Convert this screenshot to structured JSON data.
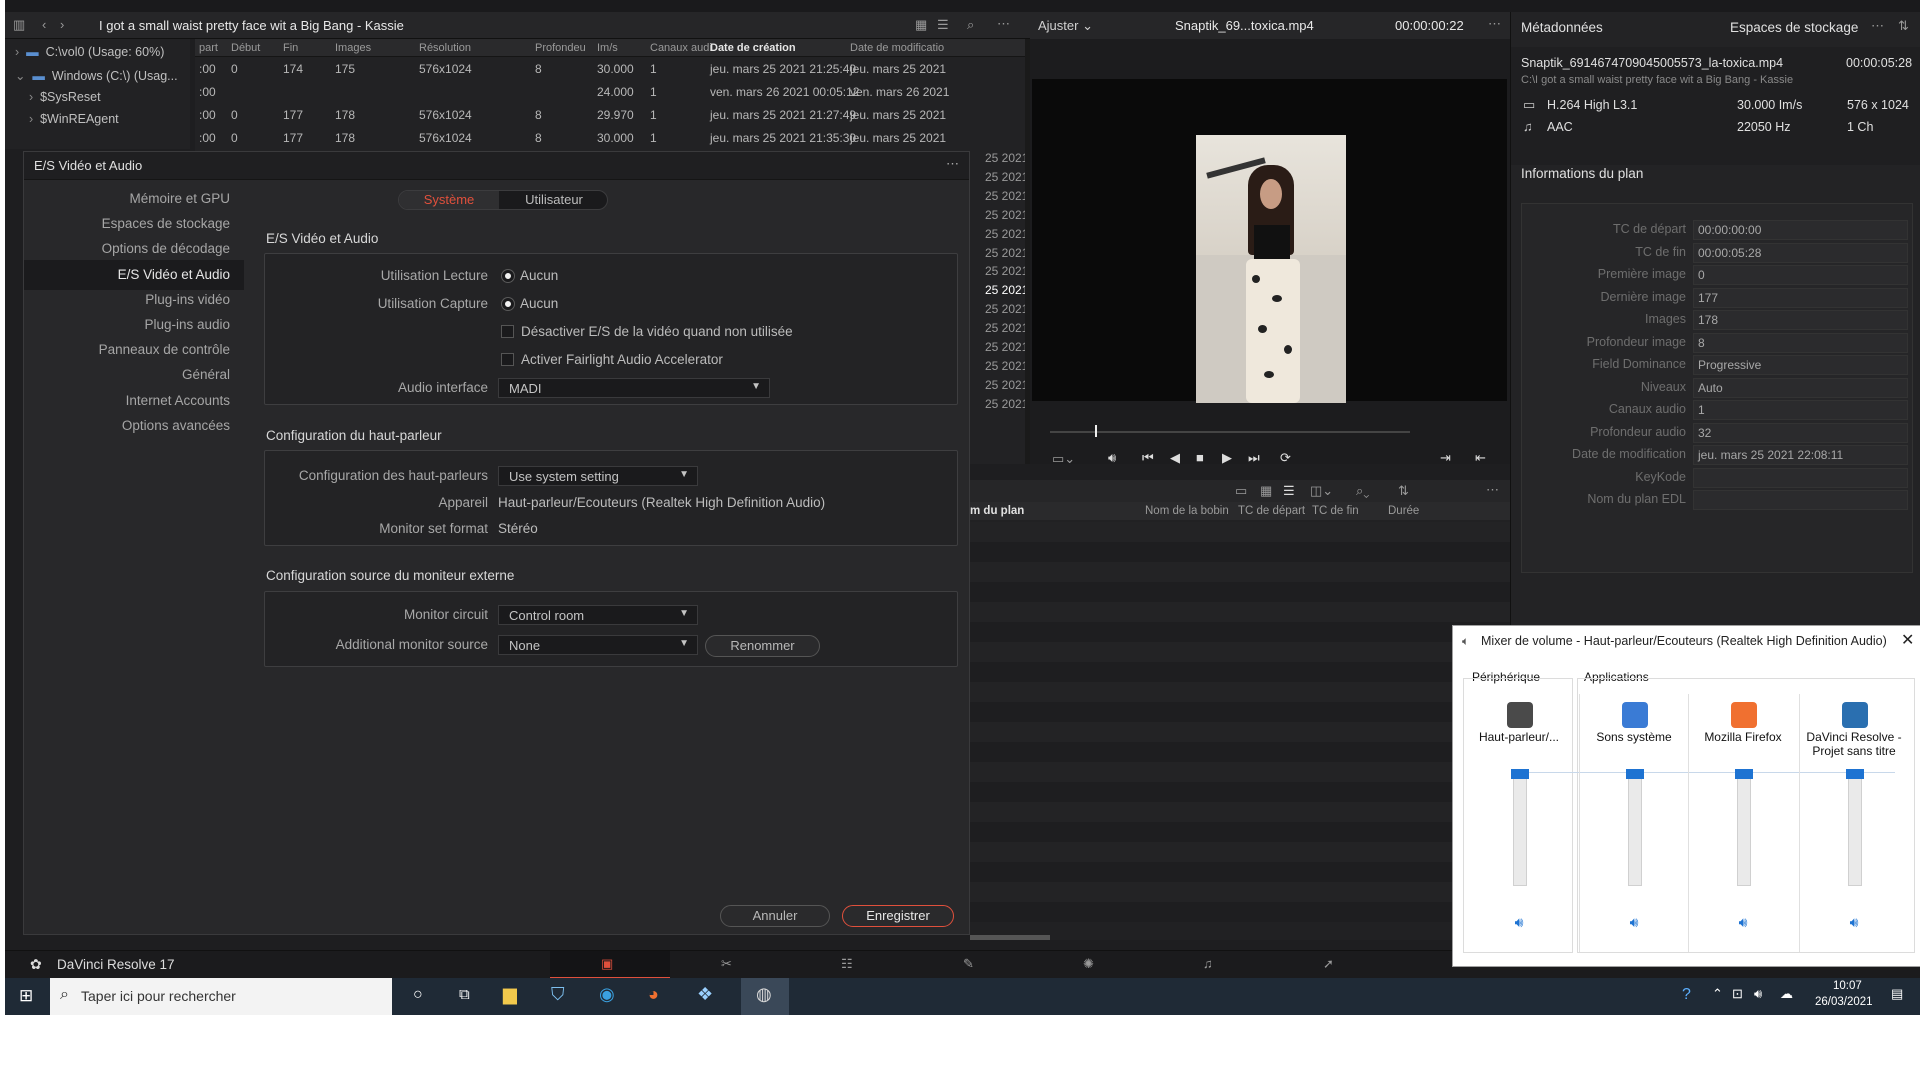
{
  "media_pool": {
    "title": "I got a small waist pretty face wit a Big Bang - Kassie",
    "tree": [
      {
        "label": "C:\\vol0 (Usage: 60%)"
      },
      {
        "label": "Windows (C:\\) (Usag..."
      },
      {
        "label": "$SysReset"
      },
      {
        "label": "$WinREAgent"
      }
    ],
    "columns": [
      "part",
      "Début",
      "Fin",
      "Images",
      "Résolution",
      "Profondeu",
      "Im/s",
      "Canaux audi",
      "Date de création",
      "Date de modificatio"
    ],
    "rows": [
      {
        "part": ":00",
        "debut": "0",
        "fin": "174",
        "images": "175",
        "resolution": "576x1024",
        "profondeur": "8",
        "fps": "30.000",
        "canaux": "1",
        "creation": "jeu. mars 25 2021 21:25:40",
        "modif": "jeu. mars 25 2021"
      },
      {
        "part": ":00",
        "debut": "",
        "fin": "",
        "images": "",
        "resolution": "",
        "profondeur": "",
        "fps": "24.000",
        "canaux": "1",
        "creation": "ven. mars 26 2021 00:05:12",
        "modif": "ven. mars 26 2021"
      },
      {
        "part": ":00",
        "debut": "0",
        "fin": "177",
        "images": "178",
        "resolution": "576x1024",
        "profondeur": "8",
        "fps": "29.970",
        "canaux": "1",
        "creation": "jeu. mars 25 2021 21:27:49",
        "modif": "jeu. mars 25 2021"
      },
      {
        "part": ":00",
        "debut": "0",
        "fin": "177",
        "images": "178",
        "resolution": "576x1024",
        "profondeur": "8",
        "fps": "30.000",
        "canaux": "1",
        "creation": "jeu. mars 25 2021 21:35:30",
        "modif": "jeu. mars 25 2021"
      }
    ],
    "more_dates": [
      "25 2021",
      "25 2021",
      "25 2021",
      "25 2021",
      "25 2021",
      "25 2021",
      "25 2021",
      "25 2021",
      "25 2021",
      "25 2021",
      "25 2021",
      "25 2021",
      "25 2021",
      "25 2021"
    ]
  },
  "viewer": {
    "fit_label": "Ajuster",
    "clip_name": "Snaptik_69...toxica.mp4",
    "timecode": "00:00:00:22"
  },
  "inspector": {
    "tab_metadata": "Métadonnées",
    "tab_storage": "Espaces de stockage",
    "file_name": "Snaptik_6914674709045005573_la-toxica.mp4",
    "duration": "00:00:05:28",
    "path": "C:\\I got a small waist pretty face wit a Big Bang - Kassie",
    "video_codec": "H.264 High L3.1",
    "video_fps": "30.000 Im/s",
    "video_res": "576 x 1024",
    "audio_codec": "AAC",
    "audio_rate": "22050 Hz",
    "audio_ch": "1 Ch",
    "section": "Informations du plan",
    "fields": [
      {
        "label": "TC de départ",
        "value": "00:00:00:00"
      },
      {
        "label": "TC de fin",
        "value": "00:00:05:28"
      },
      {
        "label": "Première image",
        "value": "0"
      },
      {
        "label": "Dernière image",
        "value": "177"
      },
      {
        "label": "Images",
        "value": "178"
      },
      {
        "label": "Profondeur image",
        "value": "8"
      },
      {
        "label": "Field Dominance",
        "value": "Progressive"
      },
      {
        "label": "Niveaux",
        "value": "Auto"
      },
      {
        "label": "Canaux audio",
        "value": "1"
      },
      {
        "label": "Profondeur audio",
        "value": "32"
      },
      {
        "label": "Date de modification",
        "value": "jeu. mars 25 2021 22:08:11"
      },
      {
        "label": "KeyKode",
        "value": ""
      },
      {
        "label": "Nom du plan EDL",
        "value": ""
      }
    ]
  },
  "dialog": {
    "title": "E/S Vidéo et Audio",
    "tab_system": "Système",
    "tab_user": "Utilisateur",
    "nav": [
      "Mémoire et GPU",
      "Espaces de stockage",
      "Options de décodage",
      "E/S Vidéo et Audio",
      "Plug-ins vidéo",
      "Plug-ins audio",
      "Panneaux de contrôle",
      "Général",
      "Internet Accounts",
      "Options avancées"
    ],
    "section_io": "E/S Vidéo et Audio",
    "playback_label": "Utilisation Lecture",
    "playback_value": "Aucun",
    "capture_label": "Utilisation Capture",
    "capture_value": "Aucun",
    "disable_io_label": "Désactiver E/S de la vidéo quand non utilisée",
    "fairlight_label": "Activer Fairlight Audio Accelerator",
    "audio_interface_label": "Audio interface",
    "audio_interface_value": "MADI",
    "section_speaker": "Configuration du haut-parleur",
    "speaker_config_label": "Configuration des haut-parleurs",
    "speaker_config_value": "Use system setting",
    "device_label": "Appareil",
    "device_value": "Haut-parleur/Ecouteurs (Realtek High Definition Audio)",
    "monitor_format_label": "Monitor set format",
    "monitor_format_value": "Stéréo",
    "section_external": "Configuration source du moniteur externe",
    "monitor_circuit_label": "Monitor circuit",
    "monitor_circuit_value": "Control room",
    "additional_source_label": "Additional monitor source",
    "additional_source_value": "None",
    "rename_button": "Renommer",
    "cancel_button": "Annuler",
    "save_button": "Enregistrer"
  },
  "lower_pane": {
    "columns": [
      "m du plan",
      "Nom de la bobin",
      "TC de départ",
      "TC de fin",
      "Durée"
    ]
  },
  "resolve_bar": {
    "app_name": "DaVinci Resolve 17"
  },
  "taskbar": {
    "search_placeholder": "Taper ici pour rechercher",
    "time": "10:07",
    "date": "26/03/2021"
  },
  "mixer": {
    "title": "Mixer de volume - Haut-parleur/Ecouteurs (Realtek High Definition Audio)",
    "device_group": "Périphérique",
    "apps_group": "Applications",
    "channels": [
      {
        "name": "Haut-parleur/...",
        "level": 1.0
      },
      {
        "name": "Sons système",
        "level": 1.0
      },
      {
        "name": "Mozilla Firefox",
        "level": 1.0
      },
      {
        "name": "DaVinci Resolve - Projet sans titre",
        "level": 1.0
      }
    ]
  },
  "colors": {
    "accent_red": "#e0503c",
    "mixer_blue": "#1e73d2"
  }
}
